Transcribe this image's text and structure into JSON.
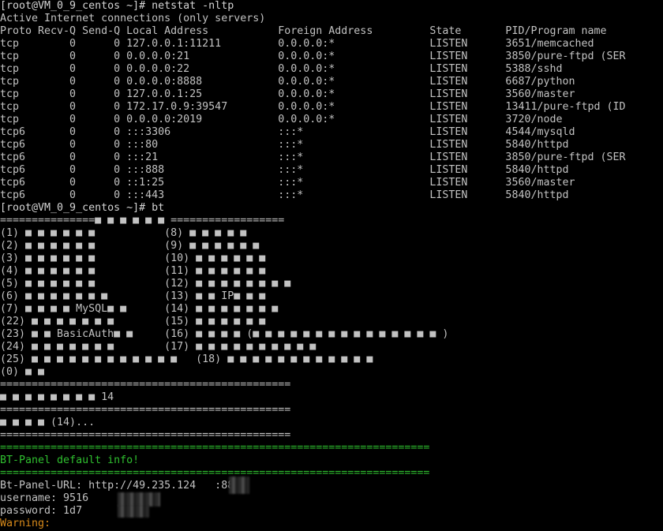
{
  "terminal": {
    "lines": [
      "[root@VM_0_9_centos ~]# netstat -nltp",
      "Active Internet connections (only servers)",
      "Proto Recv-Q Send-Q Local Address           Foreign Address         State       PID/Program name",
      "tcp        0      0 127.0.0.1:11211         0.0.0.0:*               LISTEN      3651/memcached",
      "tcp        0      0 0.0.0.0:21              0.0.0.0:*               LISTEN      3850/pure-ftpd (SER",
      "tcp        0      0 0.0.0.0:22              0.0.0.0:*               LISTEN      5388/sshd",
      "tcp        0      0 0.0.0.0:8888            0.0.0.0:*               LISTEN      6687/python",
      "tcp        0      0 127.0.0.1:25            0.0.0.0:*               LISTEN      3560/master",
      "tcp        0      0 172.17.0.9:39547        0.0.0.0:*               LISTEN      13411/pure-ftpd (ID",
      "tcp        0      0 0.0.0.0:2019            0.0.0.0:*               LISTEN      3720/node",
      "tcp6       0      0 :::3306                 :::*                    LISTEN      4544/mysqld",
      "tcp6       0      0 :::80                   :::*                    LISTEN      5840/httpd",
      "tcp6       0      0 :::21                   :::*                    LISTEN      3850/pure-ftpd (SER",
      "tcp6       0      0 :::888                  :::*                    LISTEN      5840/httpd",
      "tcp6       0      0 ::1:25                  :::*                    LISTEN      3560/master",
      "tcp6       0      0 :::443                  :::*                    LISTEN      5840/httpd",
      "[root@VM_0_9_centos ~]# bt",
      "===============■ ■ ■ ■ ■ ■ ==================",
      "(1) ■ ■ ■ ■ ■ ■           (8) ■ ■ ■ ■ ■",
      "(2) ■ ■ ■ ■ ■ ■           (9) ■ ■ ■ ■ ■ ■",
      "(3) ■ ■ ■ ■ ■ ■           (10) ■ ■ ■ ■ ■ ■",
      "(4) ■ ■ ■ ■ ■ ■           (11) ■ ■ ■ ■ ■ ■",
      "(5) ■ ■ ■ ■ ■ ■           (12) ■ ■ ■ ■ ■ ■ ■ ■",
      "(6) ■ ■ ■ ■ ■ ■ ■         (13) ■ ■ IP■ ■ ■",
      "(7) ■ ■ ■ ■ MySQL■ ■      (14) ■ ■ ■ ■ ■ ■ ■",
      "(22) ■ ■ ■ ■ ■ ■ ■        (15) ■ ■ ■ ■ ■ ■",
      "(23) ■ ■ BasicAuth■ ■     (16) ■ ■ ■ ■ (■ ■ ■ ■ ■ ■ ■ ■ ■ ■ ■ ■ ■ ■ ■ )",
      "(24) ■ ■ ■ ■ ■ ■ ■        (17) ■ ■ ■ ■ ■ ■ ■ ■ ■ ■",
      "(25) ■ ■ ■ ■ ■ ■ ■ ■ ■ ■ ■ ■   (18) ■ ■ ■ ■ ■ ■ ■ ■ ■ ■ ■ ■",
      "(0) ■ ■",
      "==============================================",
      "■ ■ ■ ■ ■ ■ ■ ■ 14",
      "==============================================",
      "■ ■ ■ ■ (14)...",
      "==============================================",
      "====================================================================",
      "BT-Panel default info!",
      "====================================================================",
      "Bt-Panel-URL: http://49.235.124   :8888",
      "username: 9516",
      "password: 1d7",
      "Warning:"
    ]
  },
  "colors": {
    "background": "#000000",
    "text": "#c2c2c2",
    "green": "#2fbf2f",
    "orange": "#d88a1a"
  }
}
